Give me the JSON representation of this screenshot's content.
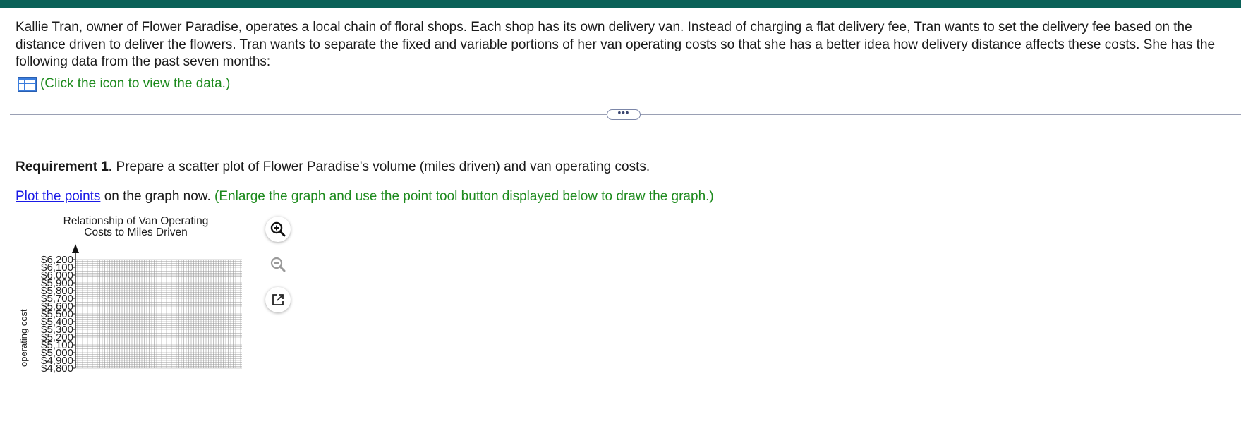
{
  "problem": {
    "text": "Kallie Tran, owner of Flower Paradise, operates a local chain of floral shops. Each shop has its own delivery van. Instead of charging a flat delivery fee, Tran wants to set the delivery fee based on the distance driven to deliver the flowers. Tran wants to separate the fixed and variable portions of her van operating costs so that she has a better idea how delivery distance affects these costs. She has the following data from the past seven months:",
    "data_link": "(Click the icon to view the data.)"
  },
  "requirement": {
    "label": "Requirement 1.",
    "text": " Prepare a scatter plot of Flower Paradise's volume (miles driven) and van operating costs."
  },
  "instruction": {
    "link": "Plot the points",
    "text": " on the graph now. ",
    "hint": "(Enlarge the graph and use the point tool button displayed below to draw the graph.)"
  },
  "graph": {
    "title_line1": "Relationship of Van Operating",
    "title_line2": "Costs to Miles Driven",
    "ylabel": "operating cost"
  },
  "chart_data": {
    "type": "scatter",
    "title": "Relationship of Van Operating Costs to Miles Driven",
    "ylabel": "operating cost",
    "xlabel": "",
    "y_ticks": [
      "$6,200",
      "$6,100",
      "$6,000",
      "$5,900",
      "$5,800",
      "$5,700",
      "$5,600",
      "$5,500",
      "$5,400",
      "$5,300",
      "$5,200",
      "$5,100",
      "$5,000",
      "$4,900",
      "$4,800"
    ],
    "ylim": [
      4800,
      6200
    ],
    "series": [],
    "grid": true
  },
  "colors": {
    "topbar": "#0a6158",
    "link_green": "#1d8a1d",
    "link_blue": "#1a1ae6",
    "grid": "#9a9a9a"
  },
  "icons": {
    "data": "table-grid-icon",
    "zoom_in": "zoom-in-icon",
    "zoom_out": "zoom-out-icon",
    "popout": "popout-icon"
  }
}
